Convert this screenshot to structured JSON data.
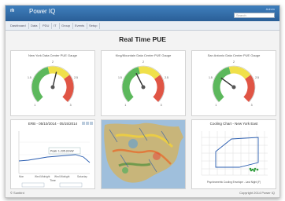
{
  "header": {
    "brand": "ṁ",
    "title": "Power IQ",
    "user": "Admin",
    "search_placeholder": "Search"
  },
  "tabs": [
    "Dashboard",
    "Data",
    "PDU",
    "IT",
    "Group",
    "Events",
    "Setup"
  ],
  "page": {
    "title": "Real Time PUE"
  },
  "gauges": [
    {
      "title": "New York Data Center PUE Gauge",
      "value": 2.1,
      "min": 1.0,
      "max": 3.0,
      "ticks": [
        "1",
        "1.5",
        "2",
        "2.5",
        "3"
      ]
    },
    {
      "title": "King/Mountain Data Center PUE Gauge",
      "value": 1.8,
      "min": 1.0,
      "max": 3.0,
      "ticks": [
        "1",
        "1.5",
        "2",
        "2.5",
        "3"
      ]
    },
    {
      "title": "San Antonio Data Center PUE Gauge",
      "value": 1.6,
      "min": 1.0,
      "max": 3.0,
      "ticks": [
        "1",
        "1.5",
        "2",
        "2.5",
        "3"
      ]
    }
  ],
  "line_panel": {
    "title": "ERB - 05/10/2014 - 05/15/2014",
    "xlabels": [
      "Mon",
      "Wed Midnight",
      "Wed Midnight",
      "Saturday"
    ],
    "xlabel": "Time",
    "tooltip": "Peak: 1,235.33 kW"
  },
  "map_panel": {
    "title": "Weather Map"
  },
  "cooling_panel": {
    "title": "Cooling Chart - New York East",
    "xlabel": "Psychrometric Cooling Envelope - Last Night (F)"
  },
  "footer": {
    "left": "© Sunbird",
    "right": "Copyright 2014 Power IQ"
  },
  "colors": {
    "header": "#2f6aa6",
    "gauge_green": "#5cb85c",
    "gauge_yellow": "#f0e04a",
    "gauge_red": "#e05545",
    "line": "#2a5db0"
  }
}
